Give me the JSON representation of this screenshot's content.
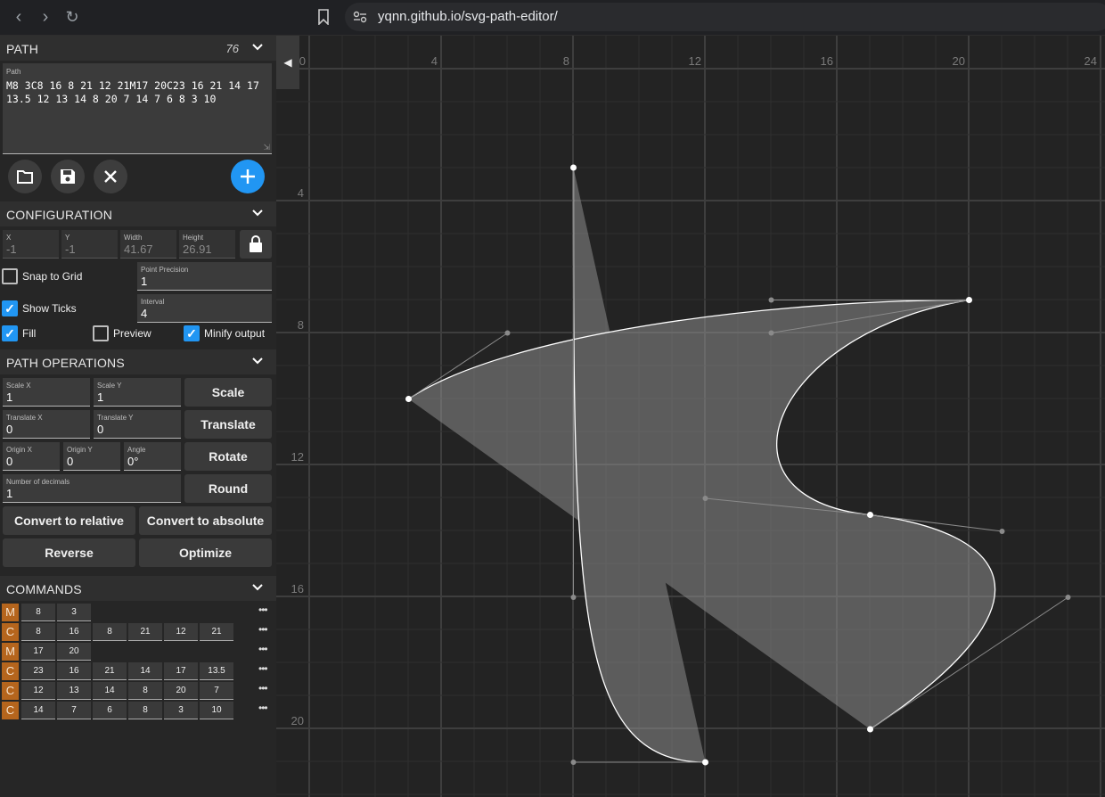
{
  "browser": {
    "url": "yqnn.github.io/svg-path-editor/"
  },
  "path_section": {
    "title": "PATH",
    "count": "76",
    "field_label": "Path",
    "path_text": "M8 3C8 16 8 21 12 21M17 20C23 16 21 14 17 13.5 12 13 14 8 20 7 14 7 6 8 3 10"
  },
  "configuration": {
    "title": "CONFIGURATION",
    "x": {
      "label": "X",
      "value": "-1"
    },
    "y": {
      "label": "Y",
      "value": "-1"
    },
    "width": {
      "label": "Width",
      "value": "41.67"
    },
    "height": {
      "label": "Height",
      "value": "26.91"
    },
    "snap_to_grid": "Snap to Grid",
    "point_precision": {
      "label": "Point Precision",
      "value": "1"
    },
    "show_ticks": "Show Ticks",
    "interval": {
      "label": "Interval",
      "value": "4"
    },
    "fill": "Fill",
    "preview": "Preview",
    "minify_output": "Minify output"
  },
  "path_operations": {
    "title": "PATH OPERATIONS",
    "scale_x": {
      "label": "Scale X",
      "value": "1"
    },
    "scale_y": {
      "label": "Scale Y",
      "value": "1"
    },
    "scale_btn": "Scale",
    "translate_x": {
      "label": "Translate X",
      "value": "0"
    },
    "translate_y": {
      "label": "Translate Y",
      "value": "0"
    },
    "translate_btn": "Translate",
    "origin_x": {
      "label": "Origin X",
      "value": "0"
    },
    "origin_y": {
      "label": "Origin Y",
      "value": "0"
    },
    "angle": {
      "label": "Angle",
      "value": "0°"
    },
    "rotate_btn": "Rotate",
    "decimals": {
      "label": "Number of decimals",
      "value": "1"
    },
    "round_btn": "Round",
    "to_relative": "Convert to relative",
    "to_absolute": "Convert to absolute",
    "reverse": "Reverse",
    "optimize": "Optimize"
  },
  "commands": {
    "title": "COMMANDS",
    "rows": [
      {
        "cmd": "M",
        "vals": [
          "8",
          "3"
        ]
      },
      {
        "cmd": "C",
        "vals": [
          "8",
          "16",
          "8",
          "21",
          "12",
          "21"
        ]
      },
      {
        "cmd": "M",
        "vals": [
          "17",
          "20"
        ]
      },
      {
        "cmd": "C",
        "vals": [
          "23",
          "16",
          "21",
          "14",
          "17",
          "13.5"
        ]
      },
      {
        "cmd": "C",
        "vals": [
          "12",
          "13",
          "14",
          "8",
          "20",
          "7"
        ]
      },
      {
        "cmd": "C",
        "vals": [
          "14",
          "7",
          "6",
          "8",
          "3",
          "10"
        ]
      }
    ],
    "more": "•••"
  },
  "canvas": {
    "x_ticks": [
      "0",
      "4",
      "8",
      "12",
      "16",
      "20",
      "24"
    ],
    "y_ticks": [
      "4",
      "8",
      "12",
      "16",
      "20"
    ]
  }
}
